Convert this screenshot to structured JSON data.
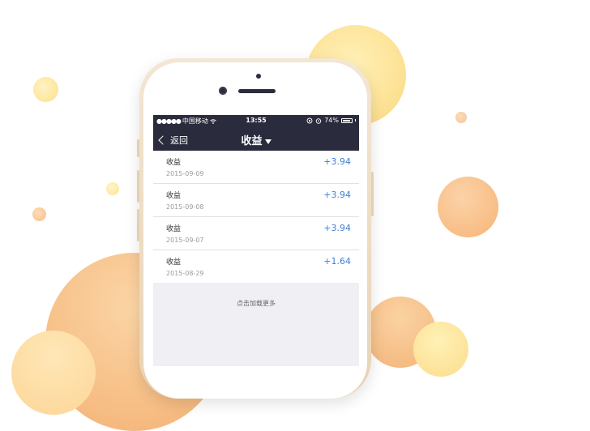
{
  "status_bar": {
    "signal": "●●●●●",
    "carrier": "中国移动",
    "time": "13:55",
    "battery": "74%"
  },
  "nav": {
    "back_label": "返回",
    "title": "收益"
  },
  "records": [
    {
      "title": "收益",
      "date": "2015-09-09",
      "amount": "+3.94"
    },
    {
      "title": "收益",
      "date": "2015-09-08",
      "amount": "+3.94"
    },
    {
      "title": "收益",
      "date": "2015-09-07",
      "amount": "+3.94"
    },
    {
      "title": "收益",
      "date": "2015-08-29",
      "amount": "+1.64"
    }
  ],
  "load_more": "点击加载更多",
  "colors": {
    "nav_bg": "#2a2c3d",
    "amount": "#3c7fd6",
    "list_bg": "#f0f0f4"
  }
}
